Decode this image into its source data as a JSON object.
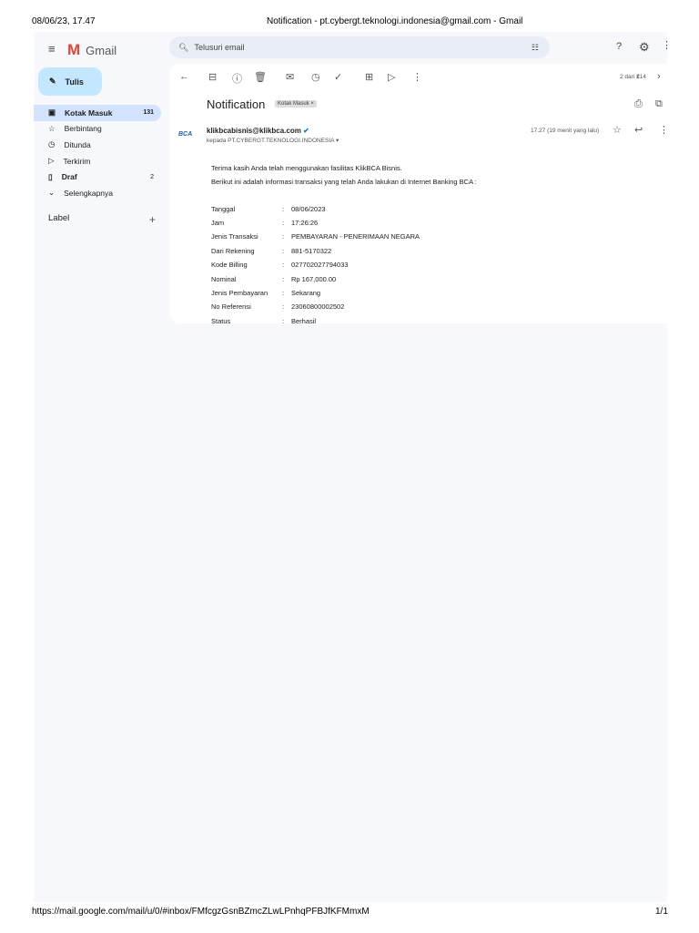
{
  "print_header": {
    "datetime": "08/06/23, 17.47",
    "title": "Notification - pt.cybergt.teknologi.indonesia@gmail.com - Gmail"
  },
  "print_footer": {
    "url": "https://mail.google.com/mail/u/0/#inbox/FMfcgzGsnBZmcZLwLPnhqPFBJfKFMmxM",
    "page": "1/1"
  },
  "app": {
    "name": "Gmail",
    "search_placeholder": "Telusuri email",
    "compose": "Tulis"
  },
  "nav": [
    {
      "label": "Kotak Masuk",
      "count": "131"
    },
    {
      "label": "Berbintang",
      "count": ""
    },
    {
      "label": "Ditunda",
      "count": ""
    },
    {
      "label": "Terkirim",
      "count": ""
    },
    {
      "label": "Draf",
      "count": "2"
    },
    {
      "label": "Selengkapnya",
      "count": ""
    }
  ],
  "labels_title": "Label",
  "toolbar": {
    "pagination": "2 dari 214"
  },
  "email": {
    "subject": "Notification",
    "chip": "Kotak Masuk ×",
    "sender": "klikbcabisnis@klikbca.com",
    "to": "kepada PT.CYBERGT.TEKNOLOGI.INDONESIA",
    "time": "17.27 (19 menit yang lalu)",
    "logo": "BCA",
    "intro1": "Terima kasih Anda telah menggunakan fasilitas KlikBCA Bisnis.",
    "intro2": "Berikut ini adalah informasi transaksi yang telah Anda lakukan di Internet Banking BCA :",
    "rows": [
      [
        "Tanggal",
        "08/06/2023"
      ],
      [
        "Jam",
        "17:26:26"
      ],
      [
        "Jenis Transaksi",
        "PEMBAYARAN - PENERIMAAN NEGARA"
      ],
      [
        "Dari Rekening",
        "881-5170322"
      ],
      [
        "Kode Billing",
        "027702027794033"
      ],
      [
        "Nominal",
        "Rp 167,000.00"
      ],
      [
        "Jenis Pembayaran",
        "Sekarang"
      ],
      [
        "No Referensi",
        "23060800002502"
      ],
      [
        "Status",
        "Berhasil"
      ]
    ]
  }
}
